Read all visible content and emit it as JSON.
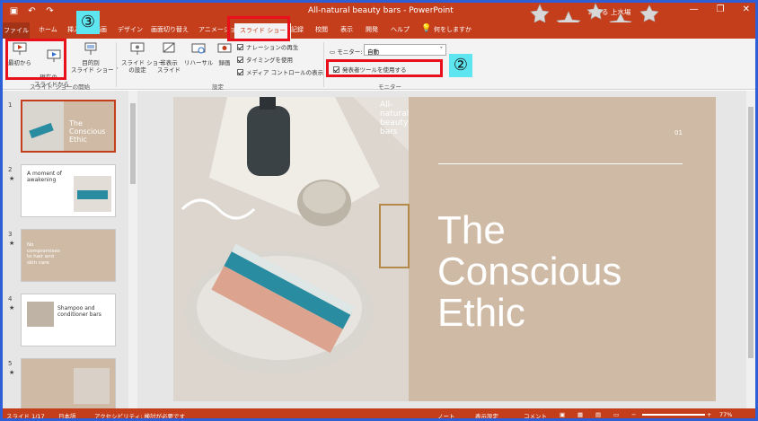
{
  "window": {
    "title": "All-natural beauty bars - PowerPoint",
    "user": "みつる 上水場",
    "minimize": "—",
    "restore": "❐",
    "close": "✕"
  },
  "tabs": [
    {
      "label": "ファイル"
    },
    {
      "label": "ホーム"
    },
    {
      "label": "挿入"
    },
    {
      "label": "描画"
    },
    {
      "label": "デザイン"
    },
    {
      "label": "画面切り替え"
    },
    {
      "label": "アニメーション"
    },
    {
      "label": "スライド ショー"
    },
    {
      "label": "記録"
    },
    {
      "label": "校閲"
    },
    {
      "label": "表示"
    },
    {
      "label": "開発"
    },
    {
      "label": "ヘルプ"
    },
    {
      "label": "何をしますか"
    }
  ],
  "ribbon": {
    "start_group": {
      "from_beginning": "最初から",
      "from_current": "現在の\nスライドから",
      "custom": "目的別\nスライド ショー ˅",
      "label": "スライド ショーの開始"
    },
    "setup_group": {
      "setup": "スライド ショー\nの設定",
      "hide": "非表示\nスライド",
      "rehearse": "リハーサル",
      "record": "録画",
      "narration": "ナレーションの再生",
      "timing": "タイミングを使用",
      "media": "メディア コントロールの表示",
      "label": "設定"
    },
    "monitor_group": {
      "monitor_label": "モニター:",
      "monitor_value": "自動",
      "presenter": "発表者ツールを使用する",
      "label": "モニター"
    }
  },
  "callouts": {
    "c2": "②",
    "c3": "③"
  },
  "thumbnails": [
    {
      "num": "1",
      "title": "The\nConscious\nEthic",
      "star": ""
    },
    {
      "num": "2",
      "title": "A moment of\nawakening",
      "star": "★"
    },
    {
      "num": "3",
      "title": "No\ncompromises\nto hair and\nskin care",
      "star": "★"
    },
    {
      "num": "4",
      "title": "Shampoo and\nconditioner bars",
      "star": "★"
    },
    {
      "num": "5",
      "title": "",
      "star": "★"
    }
  ],
  "slide": {
    "tag": "All-\nnatural\nbeauty\nbars",
    "number": "01",
    "title": "The\nConscious\nEthic"
  },
  "status": {
    "slide": "スライド 1/17",
    "lang": "日本語",
    "access": "アクセシビリティ: 検討が必要です",
    "notes": "ノート",
    "display": "表示設定",
    "comments": "コメント",
    "zoom": "77%"
  },
  "colors": {
    "accent": "#c43e1c",
    "slide_beige": "#cfbba5",
    "callout": "#5ee6f0",
    "highlight": "#e8101a"
  }
}
